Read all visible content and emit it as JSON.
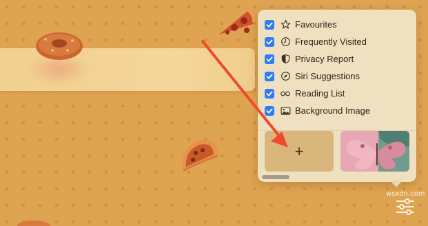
{
  "popover": {
    "options": [
      {
        "label": "Favourites",
        "icon": "star-icon",
        "checked": true
      },
      {
        "label": "Frequently Visited",
        "icon": "clock-icon",
        "checked": true
      },
      {
        "label": "Privacy Report",
        "icon": "shield-icon",
        "checked": true
      },
      {
        "label": "Siri Suggestions",
        "icon": "compass-icon",
        "checked": true
      },
      {
        "label": "Reading List",
        "icon": "glasses-icon",
        "checked": true
      },
      {
        "label": "Background Image",
        "icon": "image-icon",
        "checked": true
      }
    ],
    "add_tile_label": "+",
    "background_thumbnail": "butterfly-image"
  },
  "watermark": "wsxdn.com",
  "settings_button_icon": "sliders-icon",
  "colors": {
    "accent": "#2e7df6",
    "background": "#dfa451",
    "popover_bg": "#efe1c0",
    "annotation_arrow": "#f04a2c"
  }
}
